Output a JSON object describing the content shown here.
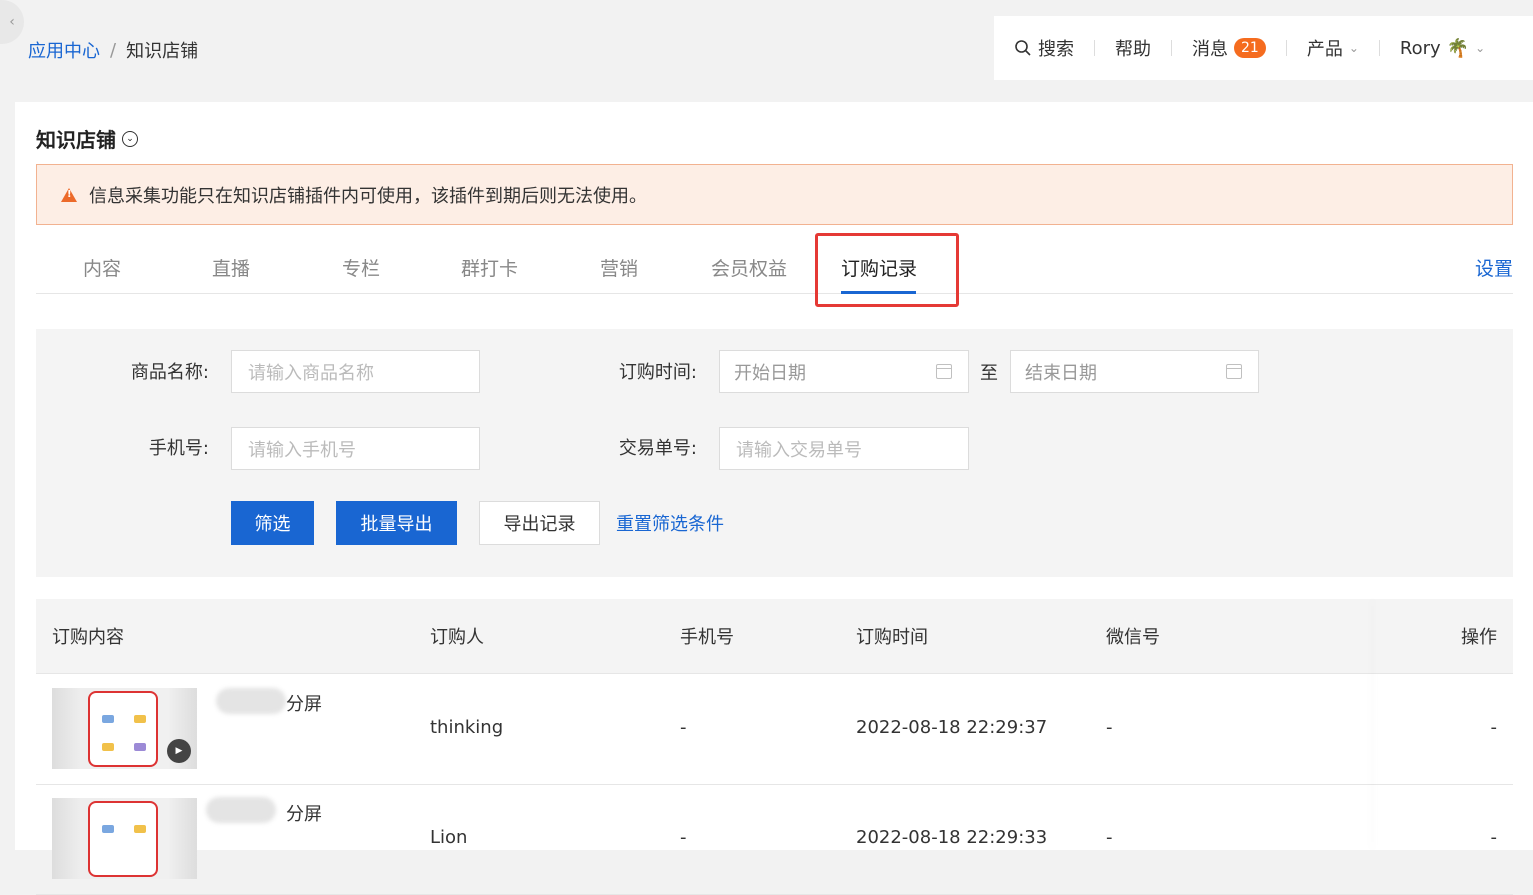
{
  "breadcrumb": {
    "parent": "应用中心",
    "sep": "/",
    "current": "知识店铺"
  },
  "topbar": {
    "search": "搜索",
    "help": "帮助",
    "messages": "消息",
    "messages_count": "21",
    "product": "产品",
    "user": "Rory"
  },
  "page": {
    "title": "知识店铺"
  },
  "alert": {
    "text": "信息采集功能只在知识店铺插件内可使用，该插件到期后则无法使用。"
  },
  "tabs": [
    "内容",
    "直播",
    "专栏",
    "群打卡",
    "营销",
    "会员权益",
    "订购记录"
  ],
  "active_tab": "订购记录",
  "settings_link": "设置",
  "filter": {
    "product_label": "商品名称:",
    "product_placeholder": "请输入商品名称",
    "time_label": "订购时间:",
    "start_placeholder": "开始日期",
    "to": "至",
    "end_placeholder": "结束日期",
    "phone_label": "手机号:",
    "phone_placeholder": "请输入手机号",
    "trade_label": "交易单号:",
    "trade_placeholder": "请输入交易单号",
    "btn_filter": "筛选",
    "btn_export": "批量导出",
    "btn_export_log": "导出记录",
    "btn_reset": "重置筛选条件"
  },
  "table": {
    "headers": [
      "订购内容",
      "订购人",
      "手机号",
      "订购时间",
      "微信号",
      "操作"
    ],
    "rows": [
      {
        "title_suffix": "分屏",
        "buyer": "thinking",
        "phone": "-",
        "time": "2022-08-18 22:29:37",
        "wechat": "-",
        "op": "-"
      },
      {
        "title_suffix": "分屏",
        "buyer": "Lion",
        "phone": "-",
        "time": "2022-08-18 22:29:33",
        "wechat": "-",
        "op": "-"
      }
    ]
  },
  "colors": {
    "accent": "#1966d2",
    "warning": "#ec6a2a",
    "highlight": "#e53935"
  }
}
